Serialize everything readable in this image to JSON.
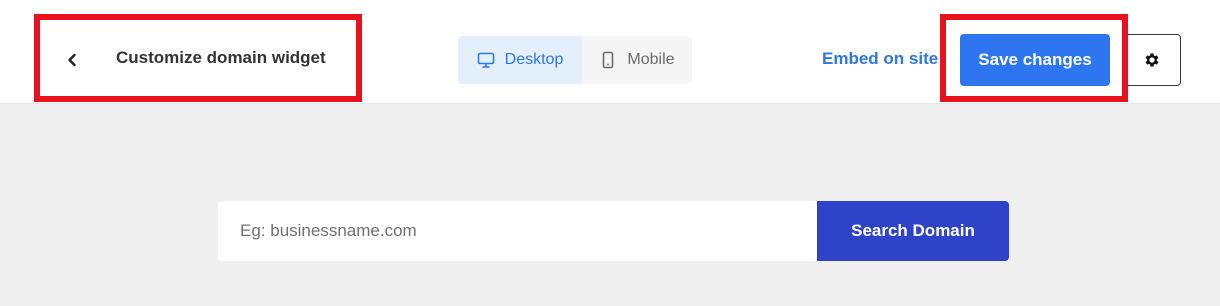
{
  "header": {
    "title": "Customize domain widget",
    "back_icon": "chevron-left-icon",
    "view_toggle": {
      "options": [
        {
          "label": "Desktop",
          "icon": "monitor-icon",
          "selected": true
        },
        {
          "label": "Mobile",
          "icon": "phone-icon",
          "selected": false
        }
      ]
    },
    "embed_label": "Embed on site",
    "save_label": "Save changes",
    "settings_icon": "gear-icon"
  },
  "widget": {
    "search_placeholder": "Eg: businessname.com",
    "search_value": "",
    "search_button_label": "Search Domain"
  },
  "colors": {
    "accent": "#2d76ef",
    "search_button": "#2e43c8",
    "highlight": "#e8121e",
    "canvas_bg": "#efefef",
    "toggle_selected_bg": "#e4effc",
    "link": "#2f76e6"
  }
}
